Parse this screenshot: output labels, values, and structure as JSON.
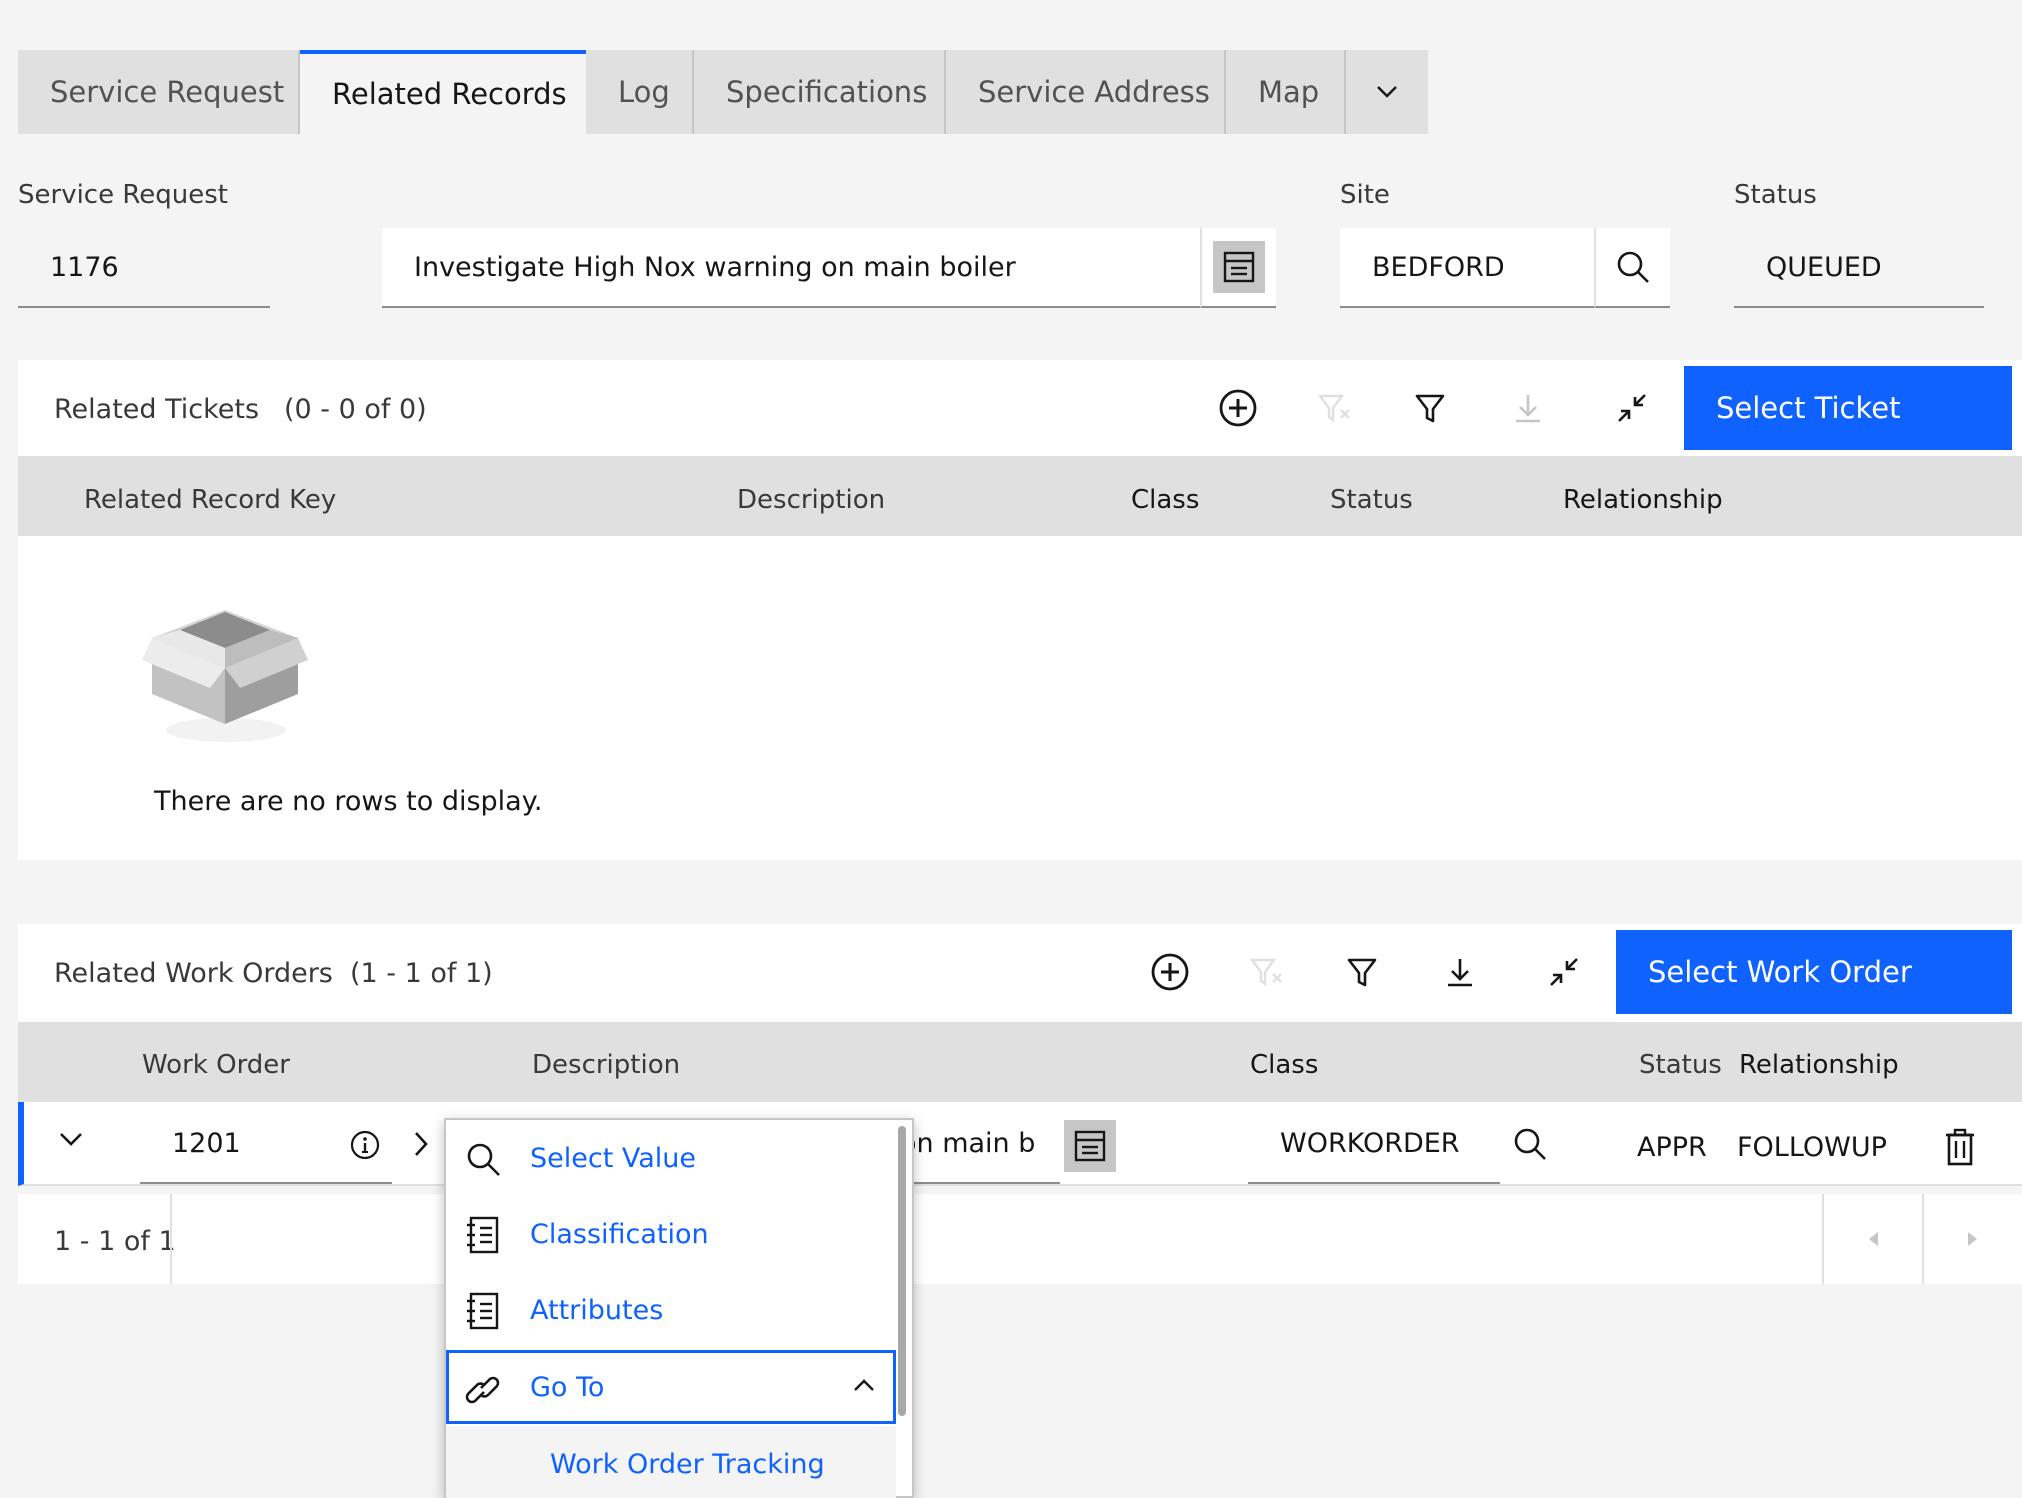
{
  "tabs": [
    {
      "label": "Service Request",
      "active": false
    },
    {
      "label": "Related Records",
      "active": true
    },
    {
      "label": "Log",
      "active": false
    },
    {
      "label": "Specifications",
      "active": false
    },
    {
      "label": "Service Address",
      "active": false
    },
    {
      "label": "Map",
      "active": false
    }
  ],
  "form": {
    "service_request_label": "Service Request",
    "service_request_value": "1176",
    "description_value": "Investigate High Nox warning on main boiler",
    "site_label": "Site",
    "site_value": "BEDFORD",
    "status_label": "Status",
    "status_value": "QUEUED"
  },
  "related_tickets": {
    "title": "Related Tickets",
    "count": "(0 - 0 of 0)",
    "primary_button": "Select Ticket",
    "columns": [
      "Related Record Key",
      "Description",
      "Class",
      "Status",
      "Relationship"
    ],
    "empty_message": "There are no rows to display."
  },
  "related_work_orders": {
    "title": "Related Work Orders",
    "count": "(1 - 1 of 1)",
    "primary_button": "Select Work Order",
    "columns": [
      "Work Order",
      "Description",
      "Class",
      "Status",
      "Relationship"
    ],
    "rows": [
      {
        "work_order": "1201",
        "description_fragment": "on main b",
        "class": "WORKORDER",
        "status": "APPR",
        "relationship": "FOLLOWUP"
      }
    ],
    "pagination": "1 - 1 of 1"
  },
  "context_menu": {
    "items": [
      {
        "label": "Select Value",
        "icon": "search-icon"
      },
      {
        "label": "Classification",
        "icon": "list-icon"
      },
      {
        "label": "Attributes",
        "icon": "list-icon"
      },
      {
        "label": "Go To",
        "icon": "link-icon",
        "expanded": true
      }
    ],
    "submenu": [
      "Work Order Tracking"
    ]
  },
  "colors": {
    "primary": "#0f62fe",
    "background": "#f4f4f4",
    "header_gray": "#e0e0e0"
  }
}
